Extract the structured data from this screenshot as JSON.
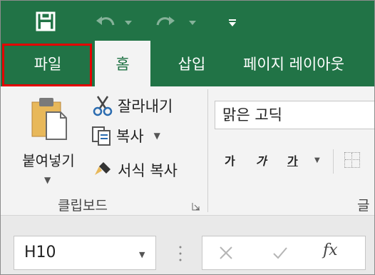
{
  "quick_access": {
    "save": "save",
    "undo": "undo",
    "redo": "redo",
    "customize": "customize"
  },
  "tabs": [
    {
      "label": "파일"
    },
    {
      "label": "홈"
    },
    {
      "label": "삽입"
    },
    {
      "label": "페이지 레이아웃"
    }
  ],
  "clipboard": {
    "paste_label": "붙여넣기",
    "cut_label": "잘라내기",
    "copy_label": "복사",
    "format_painter_label": "서식 복사",
    "group_label": "클립보드"
  },
  "font": {
    "font_name": "맑은 고딕",
    "bold_label": "가",
    "italic_label": "가",
    "underline_label": "가",
    "group_label": "글"
  },
  "formula_bar": {
    "name_box": "H10",
    "fx_label": "fx"
  },
  "colors": {
    "accent": "#217346",
    "highlight": "#e40000"
  }
}
